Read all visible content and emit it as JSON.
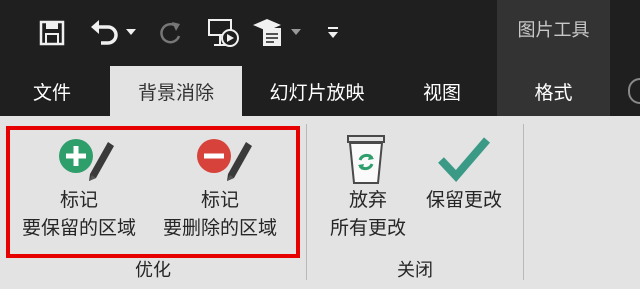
{
  "app": {
    "contextual_tab_group": "图片工具"
  },
  "qat": {
    "icons": [
      "save-icon",
      "undo-icon",
      "redo-icon",
      "from-beginning-icon",
      "present-icon",
      "customize-icon"
    ]
  },
  "tabs": [
    {
      "label": "文件"
    },
    {
      "label": "背景消除",
      "active": true
    },
    {
      "label": "幻灯片放映"
    },
    {
      "label": "视图"
    },
    {
      "label": "格式",
      "contextual": true
    }
  ],
  "ribbon": {
    "groups": [
      {
        "label": "优化",
        "buttons": [
          {
            "line1": "标记",
            "line2": "要保留的区域",
            "icon": "mark-keep-icon"
          },
          {
            "line1": "标记",
            "line2": "要删除的区域",
            "icon": "mark-remove-icon"
          }
        ]
      },
      {
        "label": "关闭",
        "buttons": [
          {
            "line1": "放弃",
            "line2": "所有更改",
            "icon": "discard-icon"
          },
          {
            "line1": "保留更改",
            "icon": "keep-changes-icon"
          }
        ]
      }
    ]
  },
  "colors": {
    "title_bar": "#1f1f1f",
    "contextual": "#333333",
    "ribbon": "#e3e3e3",
    "highlight": "#e60000",
    "plus_green": "#2e9e6a",
    "minus_red": "#d7433a",
    "check_teal": "#3a9a85"
  }
}
